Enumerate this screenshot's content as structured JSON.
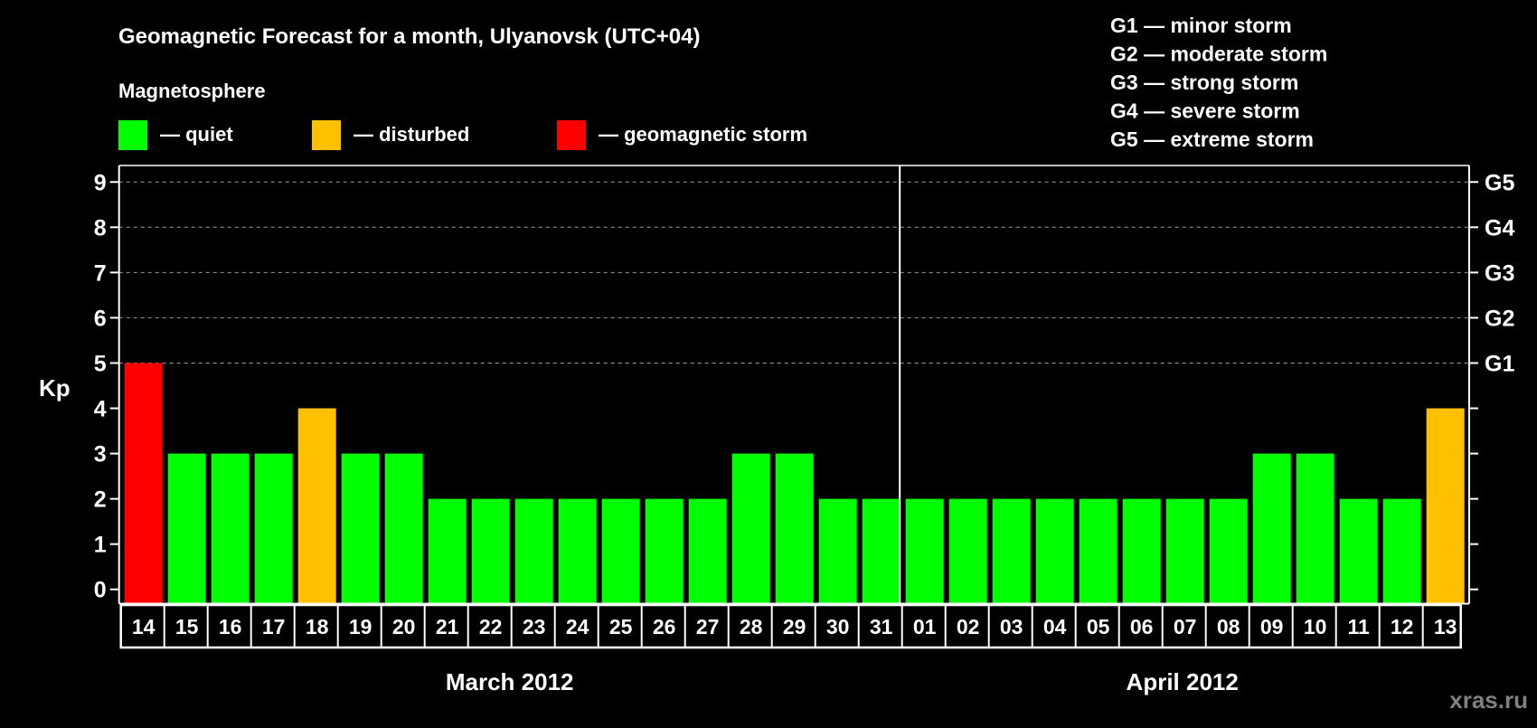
{
  "chart_data": {
    "type": "bar",
    "title": "Geomagnetic Forecast for a month, Ulyanovsk (UTC+04)",
    "ylabel": "Kp",
    "ylim": [
      0,
      9
    ],
    "yticks": [
      "0",
      "1",
      "2",
      "3",
      "4",
      "5",
      "6",
      "7",
      "8",
      "9"
    ],
    "right_ticks": [
      {
        "value": 5,
        "label": "G1"
      },
      {
        "value": 6,
        "label": "G2"
      },
      {
        "value": 7,
        "label": "G3"
      },
      {
        "value": 8,
        "label": "G4"
      },
      {
        "value": 9,
        "label": "G5"
      }
    ],
    "grid": "dashed at 5-9",
    "categories": [
      "14",
      "15",
      "16",
      "17",
      "18",
      "19",
      "20",
      "21",
      "22",
      "23",
      "24",
      "25",
      "26",
      "27",
      "28",
      "29",
      "30",
      "31",
      "01",
      "02",
      "03",
      "04",
      "05",
      "06",
      "07",
      "08",
      "09",
      "10",
      "11",
      "12",
      "13"
    ],
    "values": [
      5,
      3,
      3,
      3,
      4,
      3,
      3,
      2,
      2,
      2,
      2,
      2,
      2,
      2,
      3,
      3,
      2,
      2,
      2,
      2,
      2,
      2,
      2,
      2,
      2,
      2,
      3,
      3,
      2,
      2,
      4
    ],
    "months": [
      {
        "label": "March 2012",
        "days": 18
      },
      {
        "label": "April 2012",
        "days": 13
      }
    ],
    "legend_title": "Magnetosphere",
    "legend": [
      {
        "label": "— quiet",
        "color": "#00ff00"
      },
      {
        "label": "— disturbed",
        "color": "#ffc000"
      },
      {
        "label": "— geomagnetic storm",
        "color": "#ff0000"
      }
    ],
    "storm_scale": [
      "G1 — minor storm",
      "G2 — moderate storm",
      "G3 — strong storm",
      "G4 — severe storm",
      "G5 — extreme storm"
    ],
    "watermark": "xras.ru"
  }
}
